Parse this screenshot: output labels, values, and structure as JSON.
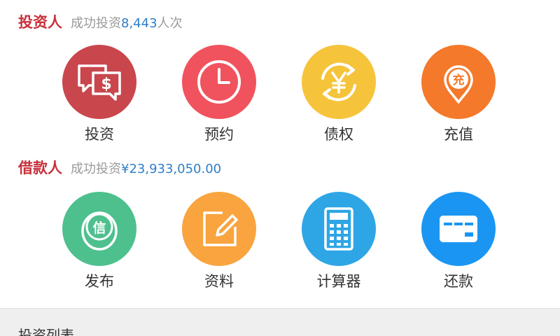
{
  "colors": {
    "section_title": "#c8303a",
    "highlight_value": "#2f7fc9",
    "invest": "#c9464d",
    "reserve": "#f0535d",
    "bond": "#f5c43b",
    "recharge": "#f4792a",
    "publish": "#4ec08e",
    "profile": "#f9a43e",
    "calculator": "#2ea6e6",
    "repay": "#1a96f2"
  },
  "investor": {
    "title": "投资人",
    "subtitle": "成功投资",
    "count": "8,443",
    "count_unit": "人次",
    "items": [
      {
        "label": "投资",
        "icon": "money-chat-icon"
      },
      {
        "label": "预约",
        "icon": "clock-icon"
      },
      {
        "label": "债权",
        "icon": "yen-exchange-icon"
      },
      {
        "label": "充值",
        "icon": "recharge-pin-icon",
        "icon_text": "充"
      }
    ]
  },
  "borrower": {
    "title": "借款人",
    "subtitle": "成功投资",
    "amount": "¥23,933,050.00",
    "items": [
      {
        "label": "发布",
        "icon": "credit-coin-icon",
        "icon_text": "信"
      },
      {
        "label": "资料",
        "icon": "edit-document-icon"
      },
      {
        "label": "计算器",
        "icon": "calculator-icon"
      },
      {
        "label": "还款",
        "icon": "bank-card-icon"
      }
    ]
  },
  "list": {
    "title": "投资列表"
  }
}
